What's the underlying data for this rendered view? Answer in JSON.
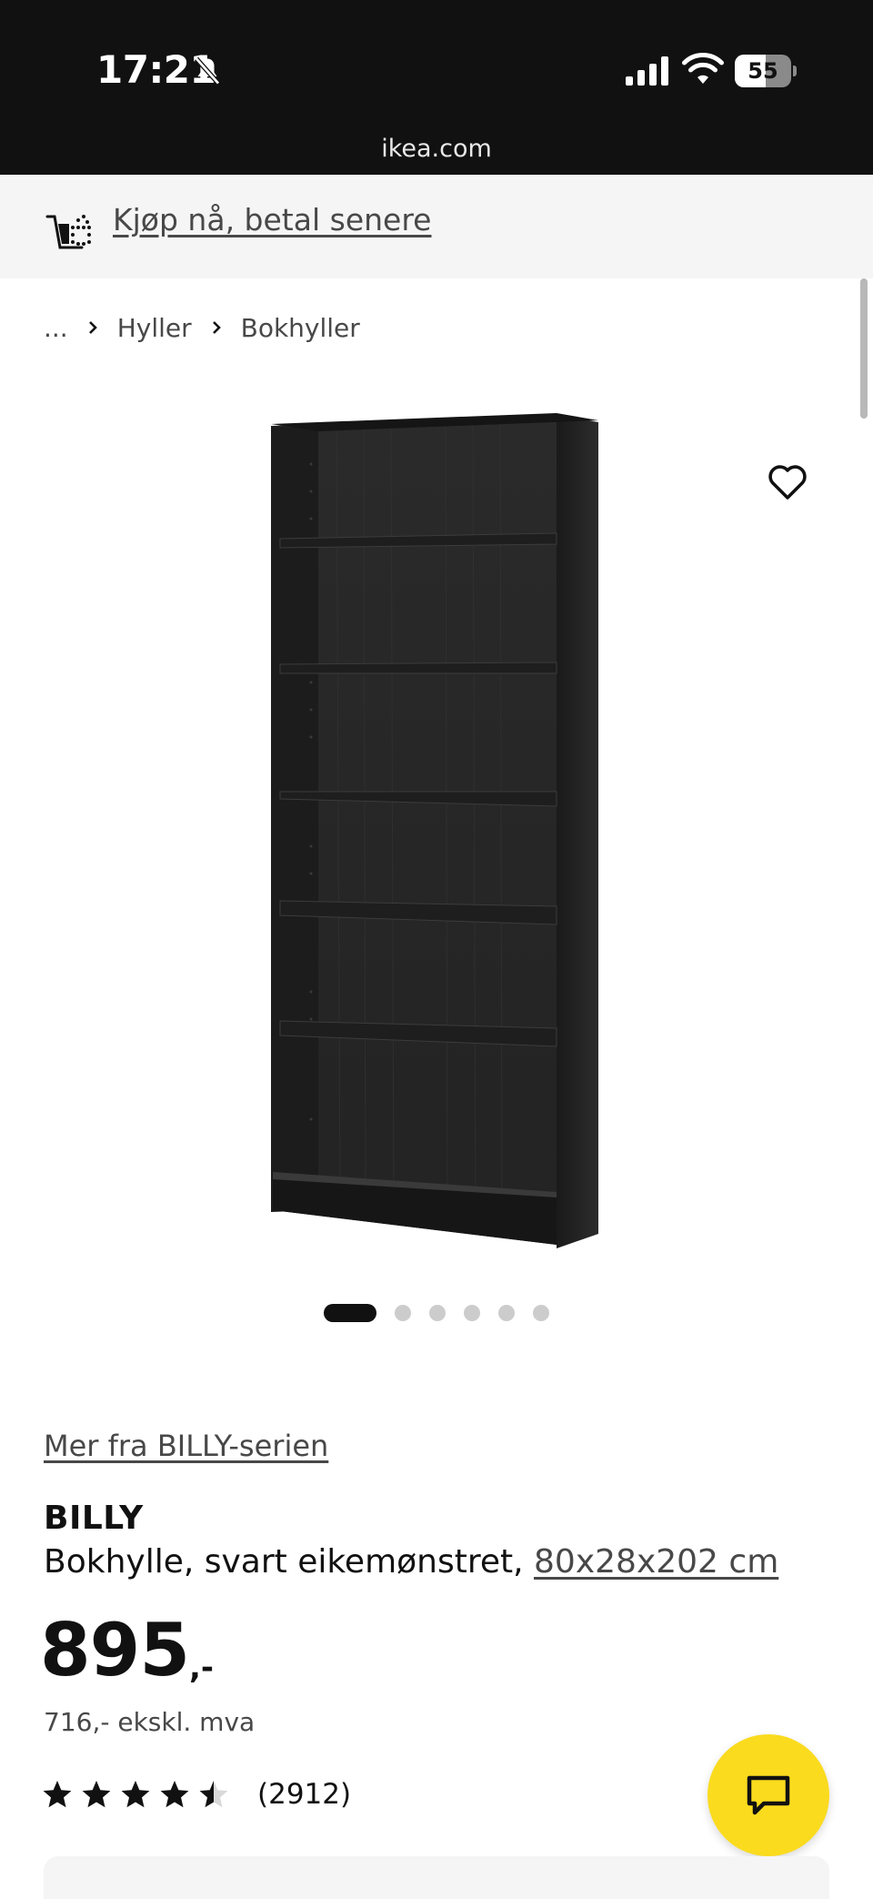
{
  "status_bar": {
    "time": "17:21",
    "battery": "55",
    "battery_fraction": 0.55
  },
  "browser": {
    "url": "ikea.com"
  },
  "promo": {
    "text": "Kjøp nå, betal senere",
    "icon": "shopping-cart-icon"
  },
  "breadcrumb": {
    "items": [
      "...",
      "Hyller",
      "Bokhyller"
    ]
  },
  "gallery": {
    "image_name": "billy-bookcase-black-oak",
    "slide_count": 6,
    "active_slide": 1,
    "favorite_icon": "heart-icon"
  },
  "product": {
    "series_link": "Mer fra BILLY-serien",
    "name": "BILLY",
    "description": "Bokhylle, svart eikemønstret, ",
    "size": "80x28x202 cm",
    "price": "895",
    "price_suffix": ",-",
    "price_ex_vat": "716,- ekskl. mva",
    "rating": 4.5,
    "rating_count": "(2912)"
  },
  "chat": {
    "icon": "chat-icon"
  },
  "colors": {
    "brand_yellow": "#fadb1e",
    "text": "#111111",
    "muted_text": "#484848"
  }
}
